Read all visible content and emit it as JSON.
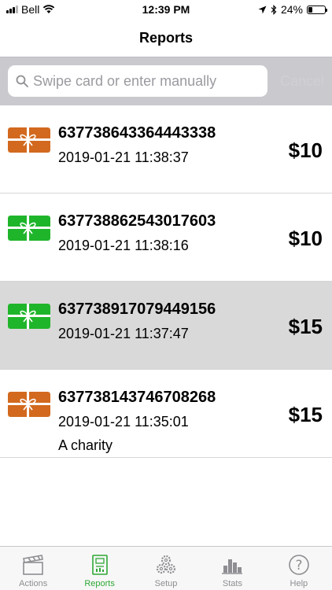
{
  "status": {
    "carrier": "Bell",
    "time": "12:39 PM",
    "battery": "24%",
    "battery_level": 0.24
  },
  "nav": {
    "title": "Reports"
  },
  "search": {
    "placeholder": "Swipe card or enter manually",
    "value": "",
    "cancel_label": "Cancel"
  },
  "colors": {
    "orange_card": "#d2691e",
    "green_card": "#1fb52b",
    "tab_active": "#2fa835",
    "tab_inactive": "#8e8e93",
    "selected_row": "#d9d9d9"
  },
  "reports": [
    {
      "number": "637738643364443338",
      "datetime": "2019-01-21 11:38:37",
      "amount": "$10",
      "card_color": "orange",
      "note": ""
    },
    {
      "number": "637738862543017603",
      "datetime": "2019-01-21 11:38:16",
      "amount": "$10",
      "card_color": "green",
      "note": ""
    },
    {
      "number": "637738917079449156",
      "datetime": "2019-01-21 11:37:47",
      "amount": "$15",
      "card_color": "green",
      "note": ""
    },
    {
      "number": "637738143746708268",
      "datetime": "2019-01-21 11:35:01",
      "amount": "$15",
      "card_color": "orange",
      "note": "A charity"
    }
  ],
  "tabs": [
    {
      "label": "Actions",
      "icon": "clapperboard-icon"
    },
    {
      "label": "Reports",
      "icon": "report-icon"
    },
    {
      "label": "Setup",
      "icon": "gears-icon"
    },
    {
      "label": "Stats",
      "icon": "bar-chart-icon"
    },
    {
      "label": "Help",
      "icon": "help-icon"
    }
  ]
}
